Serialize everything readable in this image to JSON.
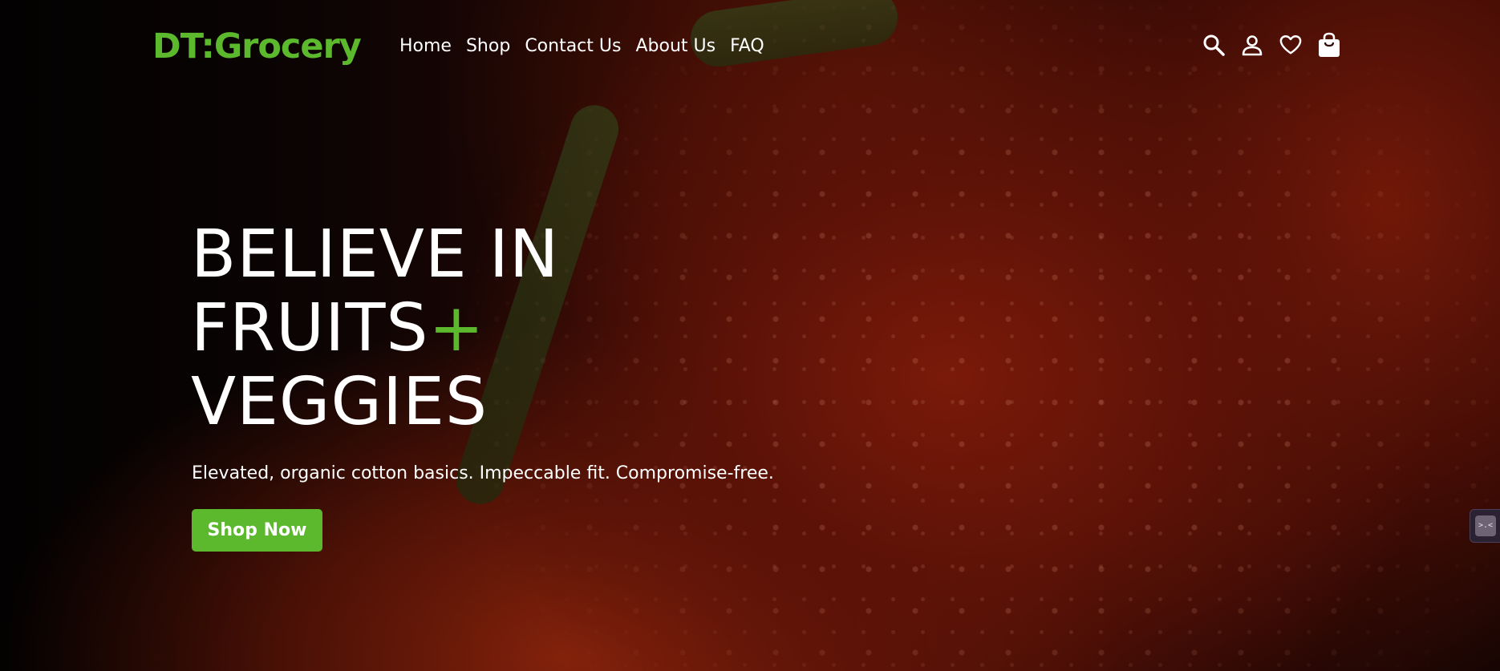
{
  "header": {
    "logo": "DT:Grocery",
    "nav": [
      "Home",
      "Shop",
      "Contact Us",
      "About Us",
      "FAQ"
    ],
    "icons": [
      "search-icon",
      "account-icon",
      "wishlist-heart-icon",
      "cart-bag-icon"
    ]
  },
  "hero": {
    "headline_line1": "BELIEVE IN",
    "headline_line2": "FRUITS",
    "headline_plus": "+",
    "headline_line3": "VEGGIES",
    "subtitle": "Elevated, organic cotton basics. Impeccable fit. Compromise-free.",
    "cta_label": "Shop Now"
  },
  "colors": {
    "accent": "#5cb82c",
    "text": "#ffffff",
    "background": "#1a0503"
  }
}
